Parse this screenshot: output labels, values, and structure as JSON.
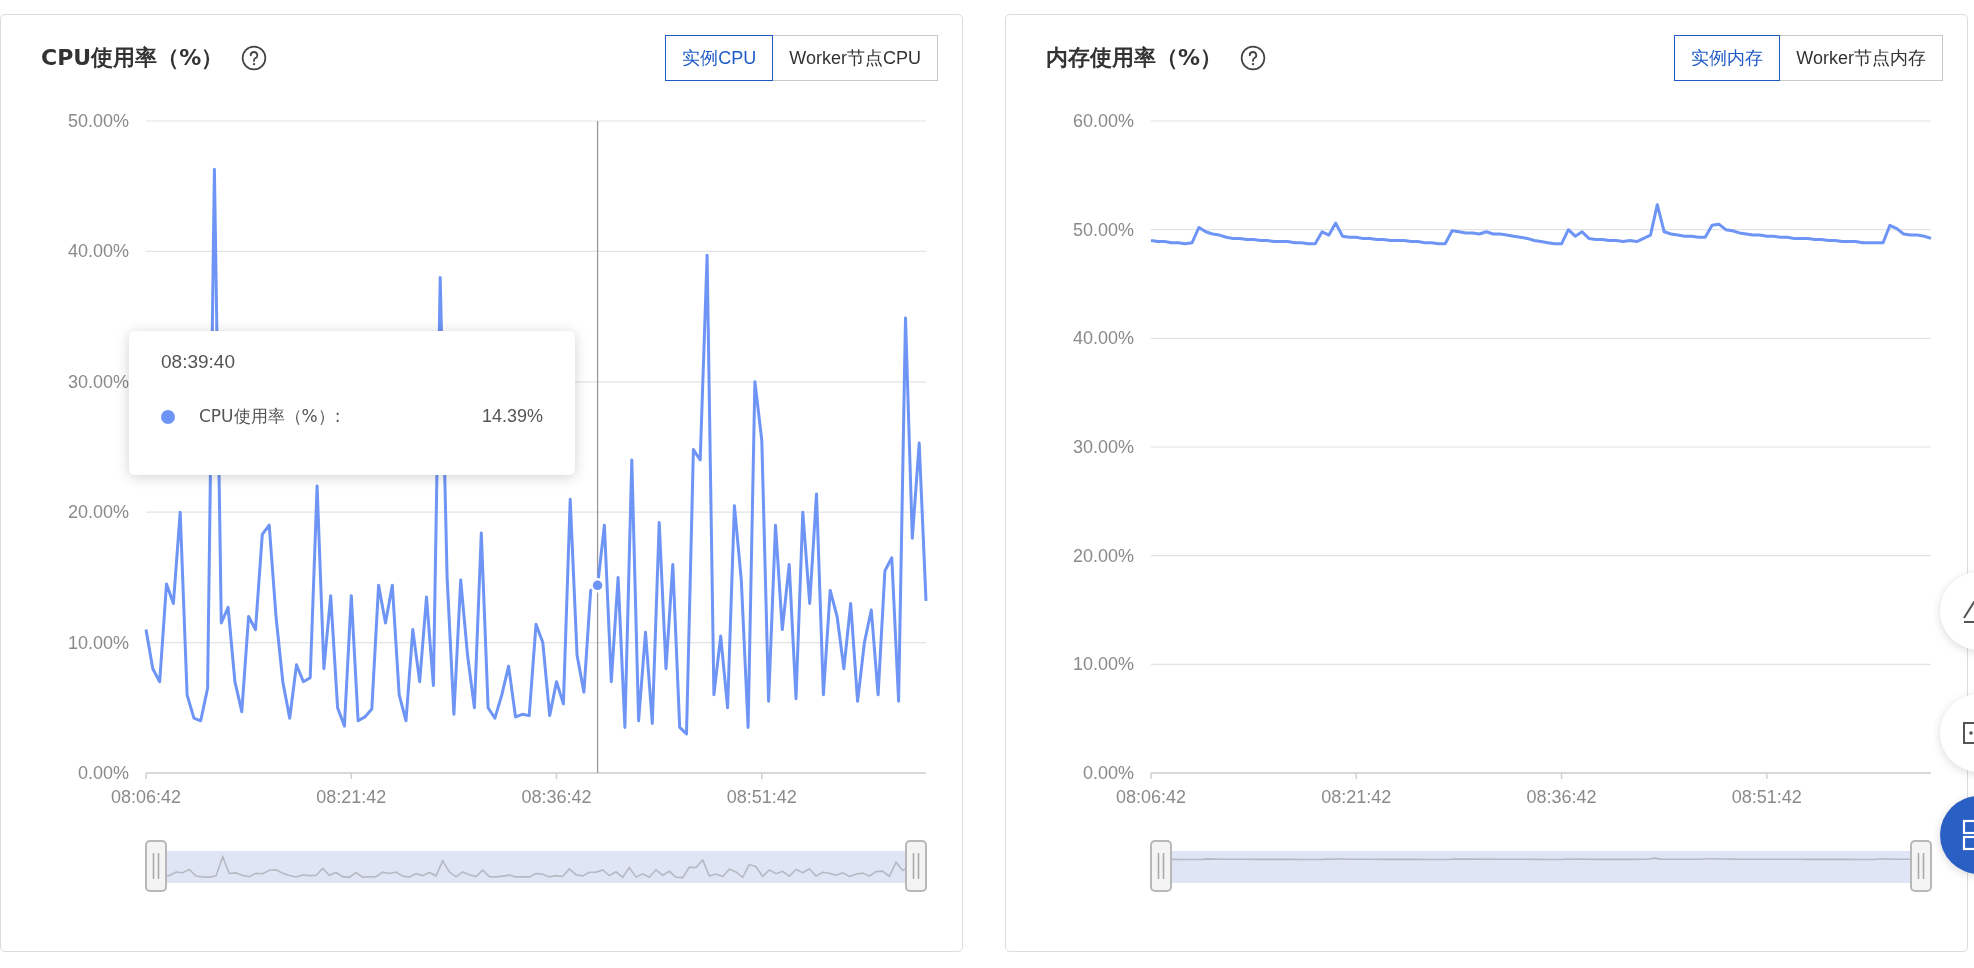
{
  "cards": [
    {
      "title": "CPU使用率（%）",
      "toggle": [
        {
          "label": "实例CPU",
          "selected": true
        },
        {
          "label": "Worker节点CPU",
          "selected": false
        }
      ],
      "chart_data": {
        "type": "line",
        "ylim": [
          0,
          50
        ],
        "grid": true,
        "categories": [
          "08:06:42",
          null,
          null,
          null,
          null,
          null,
          null,
          null,
          null,
          null,
          null,
          null,
          null,
          null,
          null,
          null,
          null,
          null,
          null,
          null,
          null,
          null,
          null,
          null,
          null,
          null,
          null,
          null,
          null,
          null,
          "08:21:42",
          null,
          null,
          null,
          null,
          null,
          null,
          null,
          null,
          null,
          null,
          null,
          null,
          null,
          null,
          null,
          null,
          null,
          null,
          null,
          null,
          null,
          null,
          null,
          null,
          null,
          null,
          null,
          null,
          null,
          "08:36:42",
          null,
          null,
          null,
          null,
          null,
          null,
          null,
          null,
          null,
          null,
          null,
          null,
          null,
          null,
          null,
          null,
          null,
          null,
          null,
          null,
          null,
          null,
          null,
          null,
          null,
          null,
          null,
          null,
          null,
          "08:51:42",
          null,
          null,
          null,
          null,
          null,
          null,
          null,
          null,
          null,
          null,
          null,
          null,
          null,
          null,
          null,
          null,
          null,
          null,
          null,
          null,
          null,
          null,
          null,
          null
        ],
        "yticks": [
          {
            "value": 0,
            "label": "0.00%"
          },
          {
            "value": 10,
            "label": "10.00%"
          },
          {
            "value": 20,
            "label": "20.00%"
          },
          {
            "value": 30,
            "label": "30.00%"
          },
          {
            "value": 40,
            "label": "40.00%"
          },
          {
            "value": 50,
            "label": "50.00%"
          }
        ],
        "series": [
          {
            "color": "#6e95f5",
            "values": [
              11,
              8,
              7,
              14.5,
              13,
              20,
              6,
              4.2,
              4,
              6.5,
              46.3,
              11.5,
              12.7,
              7,
              4.7,
              12,
              11,
              18.3,
              19,
              12,
              7,
              4.2,
              8.3,
              7,
              7.3,
              22,
              8,
              13.6,
              5,
              3.6,
              13.6,
              4,
              4.3,
              4.9,
              14.4,
              11.5,
              14.4,
              6,
              4,
              11,
              7,
              13.5,
              6.7,
              38,
              15,
              4.5,
              14.8,
              9,
              5,
              18.4,
              5,
              4.2,
              6,
              8.2,
              4.3,
              4.5,
              4.4,
              11.4,
              10,
              4.4,
              7,
              5.3,
              21,
              9,
              6.2,
              14,
              14.39,
              19,
              7,
              15,
              3.5,
              24,
              4,
              10.8,
              3.8,
              19.2,
              8,
              16,
              3.5,
              3,
              24.8,
              24,
              39.7,
              6,
              10.5,
              5,
              20.5,
              14.8,
              3.5,
              30,
              25.5,
              5.5,
              19,
              11,
              16,
              5.7,
              20,
              13,
              21.4,
              6,
              14,
              12,
              8,
              13,
              5.5,
              10,
              12.5,
              6,
              15.5,
              16.5,
              5.5,
              34.9,
              18,
              25.3,
              13.2
            ]
          }
        ]
      },
      "tooltip": {
        "time": "08:39:40",
        "label": "CPU使用率（%）:",
        "value": "14.39%"
      }
    },
    {
      "title": "内存使用率（%）",
      "toggle": [
        {
          "label": "实例内存",
          "selected": true
        },
        {
          "label": "Worker节点内存",
          "selected": false
        }
      ],
      "chart_data": {
        "type": "line",
        "ylim": [
          0,
          60
        ],
        "grid": true,
        "categories": [
          "08:06:42",
          null,
          null,
          null,
          null,
          null,
          null,
          null,
          null,
          null,
          null,
          null,
          null,
          null,
          null,
          null,
          null,
          null,
          null,
          null,
          null,
          null,
          null,
          null,
          null,
          null,
          null,
          null,
          null,
          null,
          "08:21:42",
          null,
          null,
          null,
          null,
          null,
          null,
          null,
          null,
          null,
          null,
          null,
          null,
          null,
          null,
          null,
          null,
          null,
          null,
          null,
          null,
          null,
          null,
          null,
          null,
          null,
          null,
          null,
          null,
          null,
          "08:36:42",
          null,
          null,
          null,
          null,
          null,
          null,
          null,
          null,
          null,
          null,
          null,
          null,
          null,
          null,
          null,
          null,
          null,
          null,
          null,
          null,
          null,
          null,
          null,
          null,
          null,
          null,
          null,
          null,
          null,
          "08:51:42",
          null,
          null,
          null,
          null,
          null,
          null,
          null,
          null,
          null,
          null,
          null,
          null,
          null,
          null,
          null,
          null,
          null,
          null,
          null,
          null,
          null,
          null,
          null,
          null
        ],
        "yticks": [
          {
            "value": 0,
            "label": "0.00%"
          },
          {
            "value": 10,
            "label": "10.00%"
          },
          {
            "value": 20,
            "label": "20.00%"
          },
          {
            "value": 30,
            "label": "30.00%"
          },
          {
            "value": 40,
            "label": "40.00%"
          },
          {
            "value": 50,
            "label": "50.00%"
          },
          {
            "value": 60,
            "label": "60.00%"
          }
        ],
        "series": [
          {
            "color": "#6e95f5",
            "values": [
              49,
              48.9,
              48.9,
              48.8,
              48.8,
              48.7,
              48.8,
              50.2,
              49.8,
              49.6,
              49.5,
              49.3,
              49.2,
              49.2,
              49.1,
              49.1,
              49.0,
              49.0,
              48.9,
              48.9,
              48.9,
              48.8,
              48.8,
              48.7,
              48.7,
              49.8,
              49.5,
              50.6,
              49.4,
              49.3,
              49.3,
              49.2,
              49.2,
              49.1,
              49.1,
              49.0,
              49.0,
              49.0,
              48.9,
              48.9,
              48.8,
              48.8,
              48.7,
              48.7,
              49.9,
              49.8,
              49.7,
              49.7,
              49.6,
              49.8,
              49.6,
              49.6,
              49.5,
              49.4,
              49.3,
              49.2,
              49.0,
              48.9,
              48.8,
              48.7,
              48.7,
              50.0,
              49.4,
              49.8,
              49.2,
              49.1,
              49.1,
              49.0,
              49.0,
              48.9,
              49.0,
              48.9,
              49.2,
              49.5,
              52.3,
              49.8,
              49.6,
              49.5,
              49.4,
              49.4,
              49.3,
              49.3,
              50.4,
              50.5,
              50.0,
              49.9,
              49.7,
              49.6,
              49.5,
              49.5,
              49.4,
              49.4,
              49.3,
              49.3,
              49.2,
              49.2,
              49.2,
              49.1,
              49.1,
              49.0,
              49.0,
              48.9,
              48.9,
              48.9,
              48.8,
              48.8,
              48.8,
              48.8,
              50.4,
              50.1,
              49.6,
              49.5,
              49.5,
              49.4,
              49.2
            ]
          }
        ]
      }
    }
  ]
}
